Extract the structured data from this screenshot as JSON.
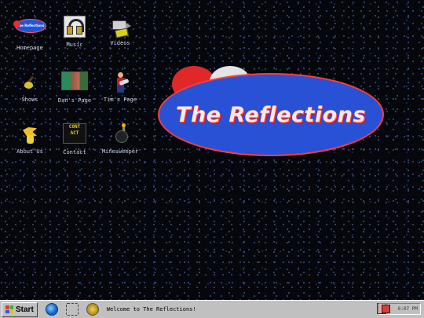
{
  "desktop": {
    "icons": [
      {
        "name": "homepage-icon",
        "label": "Homepage"
      },
      {
        "name": "music-icon",
        "label": "Music"
      },
      {
        "name": "videos-icon",
        "label": "Videos"
      },
      {
        "name": "shows-icon",
        "label": "Shows"
      },
      {
        "name": "dans-page-icon",
        "label": "Dan's Page"
      },
      {
        "name": "tims-page-icon",
        "label": "Tim's Page"
      },
      {
        "name": "about-us-icon",
        "label": "About Us"
      },
      {
        "name": "contact-icon",
        "label": "Contact"
      },
      {
        "name": "minesweeper-icon",
        "label": "Minesweeper"
      }
    ],
    "mini_logo_text": "The Reflections",
    "contact_tile_text": "CONT ACT"
  },
  "logo": {
    "text": "The Reflections"
  },
  "taskbar": {
    "start_label": "Start",
    "welcome_text": "Welcome to The Reflections!",
    "clock": "6:07 PM",
    "quick_launch": [
      "internet-explorer-icon",
      "video-tape-icon",
      "gear-icon"
    ]
  },
  "colors": {
    "logo_fill": "#2851d6",
    "logo_outline": "#ff3c3c",
    "taskbar": "#c0c0c0"
  }
}
